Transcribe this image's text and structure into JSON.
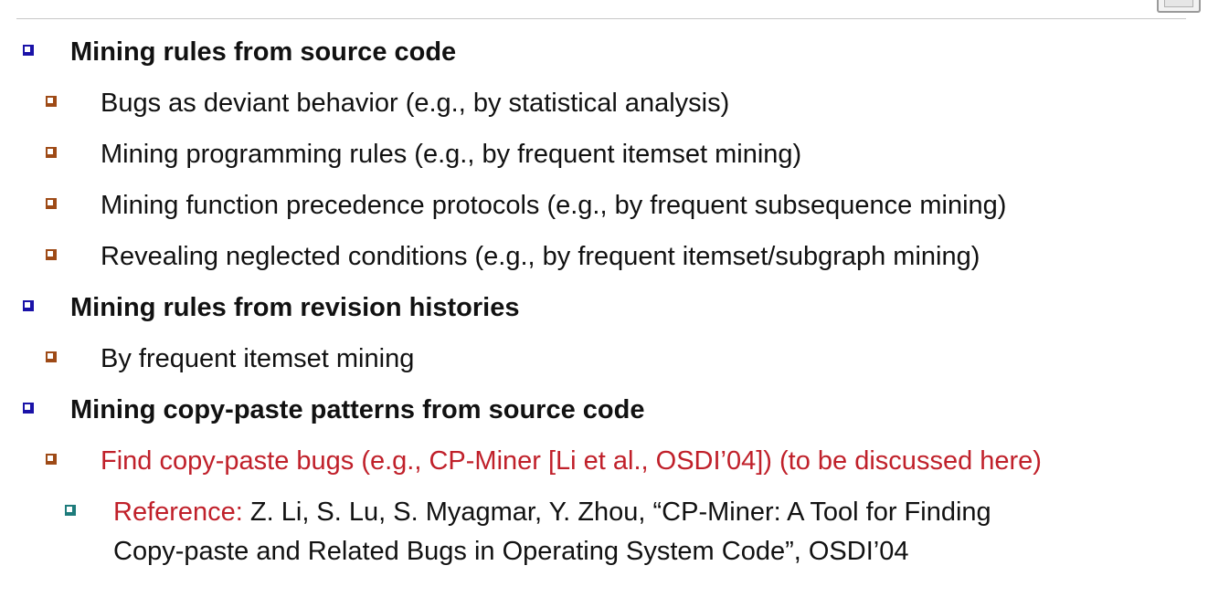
{
  "slide": {
    "items": [
      {
        "level": 1,
        "text": "Mining rules from source code"
      },
      {
        "level": 2,
        "text": "Bugs as deviant behavior (e.g., by statistical analysis)"
      },
      {
        "level": 2,
        "text": "Mining programming rules (e.g., by frequent itemset mining)"
      },
      {
        "level": 2,
        "text": "Mining function precedence protocols (e.g., by frequent subsequence mining)"
      },
      {
        "level": 2,
        "text": "Revealing neglected conditions (e.g., by frequent itemset/subgraph mining)"
      },
      {
        "level": 1,
        "text": "Mining rules from revision histories"
      },
      {
        "level": 2,
        "text": "By frequent itemset mining"
      },
      {
        "level": 1,
        "text": "Mining copy-paste patterns from source code"
      },
      {
        "level": 2,
        "text": "Find copy-paste bugs (e.g., CP-Miner [Li et al., OSDI’04])  (to be discussed here)"
      }
    ],
    "reference": {
      "label": "Reference:",
      "line1": " Z. Li, S. Lu, S. Myagmar, Y. Zhou, “CP-Miner: A Tool for Finding",
      "line2": "Copy-paste and Related Bugs in Operating System Code”, OSDI’04"
    }
  },
  "colors": {
    "bullet_level1": "#1a12a8",
    "bullet_level2": "#9e4a16",
    "bullet_level3": "#1d7b7b",
    "highlight": "#c0202a"
  }
}
